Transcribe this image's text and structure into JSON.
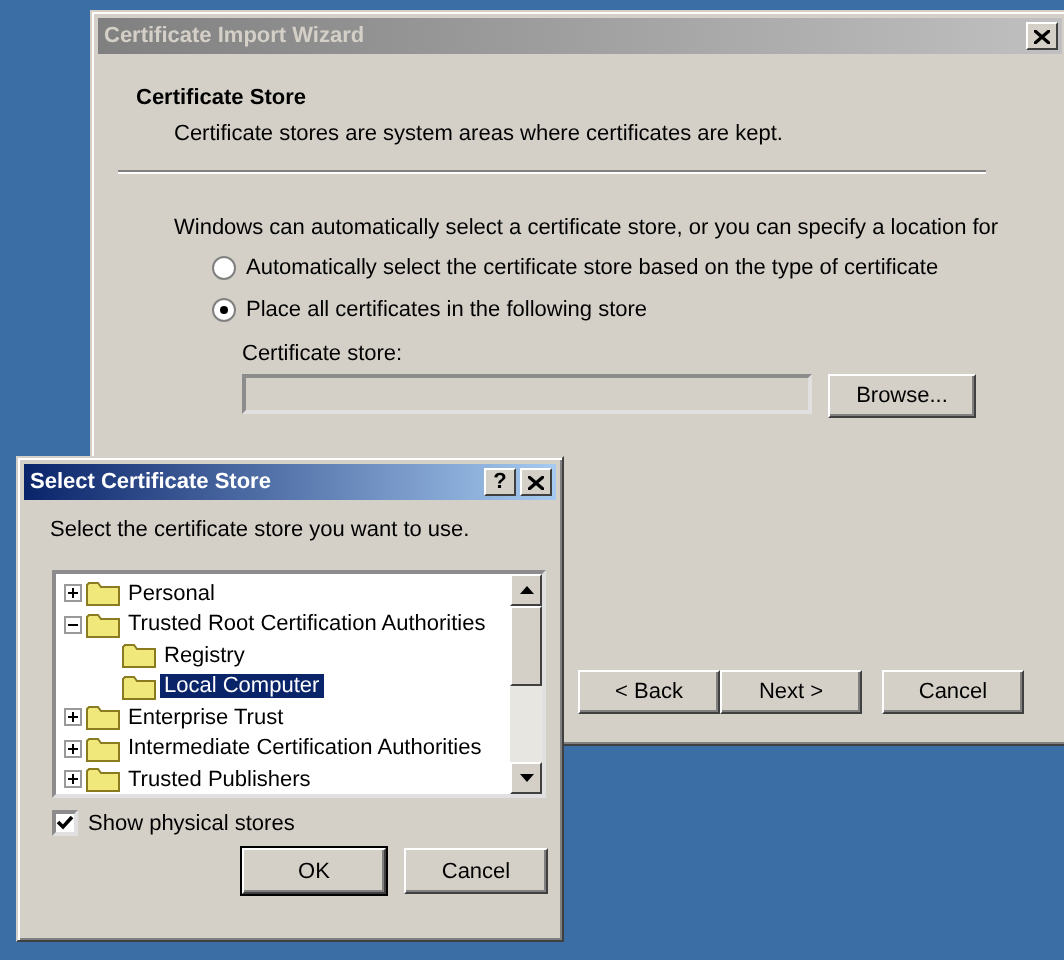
{
  "wizard": {
    "title": "Certificate Import Wizard",
    "active": false,
    "heading": "Certificate Store",
    "subheading": "Certificate stores are system areas where certificates are kept.",
    "intro": "Windows can automatically select a certificate store, or you can specify a location for",
    "options": [
      {
        "label": "Automatically select the certificate store based on the type of certificate",
        "selected": false
      },
      {
        "label": "Place all certificates in the following store",
        "selected": true
      }
    ],
    "store_label": "Certificate store:",
    "browse": "Browse...",
    "buttons": [
      "< Back",
      "Next >",
      "Cancel"
    ]
  },
  "dialog": {
    "title": "Select Certificate Store",
    "active": true,
    "help": "?",
    "prompt": "Select the certificate store you want to use.",
    "tree": [
      {
        "label": "Personal",
        "expanded": false,
        "selected": false
      },
      {
        "label": "Trusted Root Certification Authorities",
        "expanded": true,
        "selected": false,
        "children": [
          {
            "label": "Registry",
            "selected": false
          },
          {
            "label": "Local Computer",
            "selected": true
          }
        ]
      },
      {
        "label": "Enterprise Trust",
        "expanded": false,
        "selected": false
      },
      {
        "label": "Intermediate Certification Authorities",
        "expanded": false,
        "selected": false
      },
      {
        "label": "Trusted Publishers",
        "expanded": false,
        "selected": false
      }
    ],
    "show_physical": {
      "label": "Show physical stores",
      "checked": true
    },
    "buttons": [
      "OK",
      "Cancel"
    ]
  }
}
